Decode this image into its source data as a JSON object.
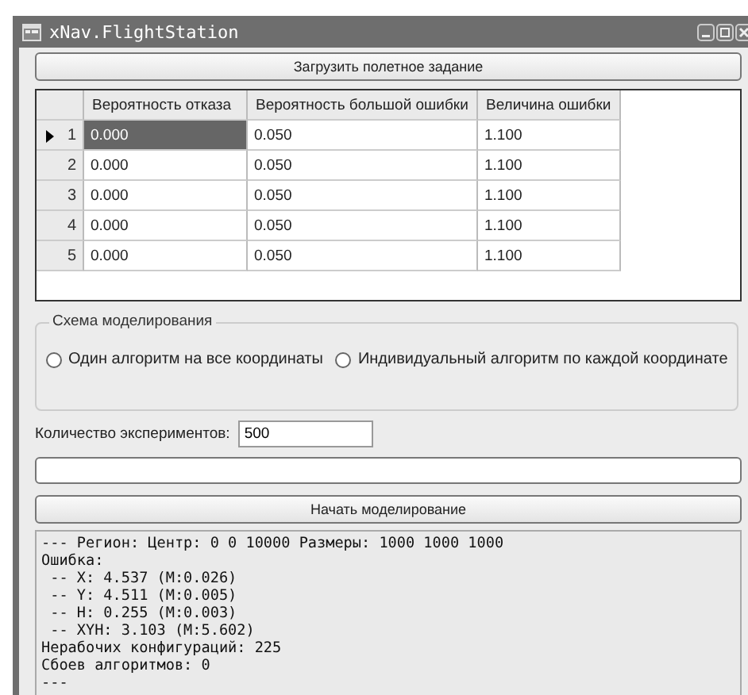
{
  "window": {
    "title": "xNav.FlightStation"
  },
  "load_button": "Загрузить полетное задание",
  "grid": {
    "columns": [
      "Вероятность отказа",
      "Вероятность большой ошибки",
      "Величина ошибки"
    ],
    "rows": [
      {
        "number": "1",
        "selected": true,
        "cells": [
          "0.000",
          "0.050",
          "1.100"
        ]
      },
      {
        "number": "2",
        "selected": false,
        "cells": [
          "0.000",
          "0.050",
          "1.100"
        ]
      },
      {
        "number": "3",
        "selected": false,
        "cells": [
          "0.000",
          "0.050",
          "1.100"
        ]
      },
      {
        "number": "4",
        "selected": false,
        "cells": [
          "0.000",
          "0.050",
          "1.100"
        ]
      },
      {
        "number": "5",
        "selected": false,
        "cells": [
          "0.000",
          "0.050",
          "1.100"
        ]
      }
    ]
  },
  "scheme": {
    "title": "Схема моделирования",
    "options": [
      {
        "label": "Один алгоритм на все координаты",
        "selected": false
      },
      {
        "label": "Индивидуальный алгоритм по каждой координате",
        "selected": false
      }
    ]
  },
  "experiments": {
    "label": "Количество экспериментов:",
    "value": "500"
  },
  "start_button": "Начать моделирование",
  "output": [
    "--- Регион: Центр: 0 0 10000 Размеры: 1000 1000 1000",
    "Ошибка:",
    " -- X: 4.537 (M:0.026)",
    " -- Y: 4.511 (M:0.005)",
    " -- H: 0.255 (M:0.003)",
    " -- XYH: 3.103 (M:5.602)",
    "Нерабочих конфигураций: 225",
    "Сбоев алгоритмов: 0",
    "---"
  ]
}
